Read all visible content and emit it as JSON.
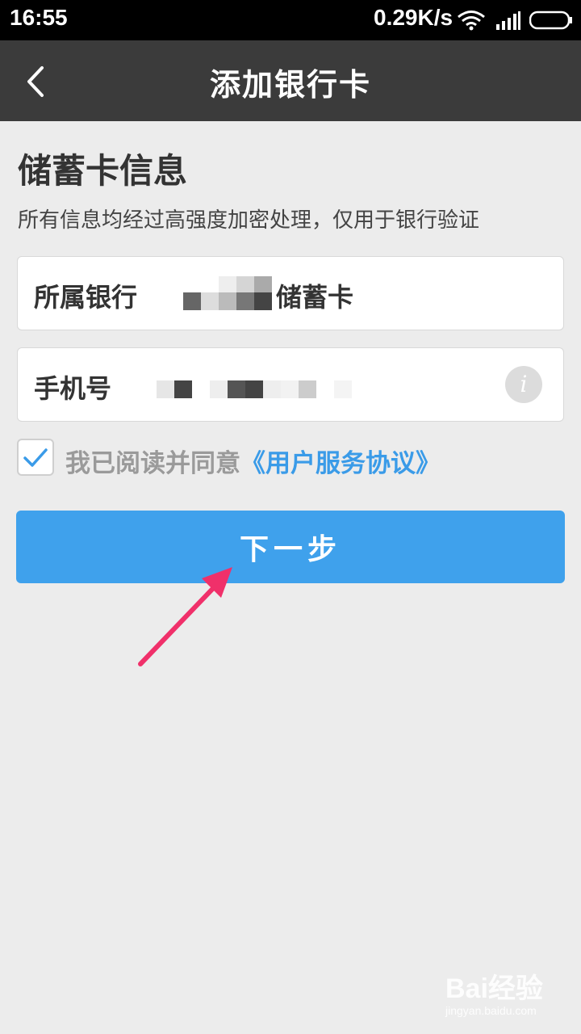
{
  "status_bar": {
    "time": "16:55",
    "speed": "0.29K/s",
    "icons": [
      "wifi-icon",
      "signal-icon",
      "battery-icon"
    ]
  },
  "nav": {
    "title": "添加银行卡",
    "back_icon": "chevron-left-icon"
  },
  "section": {
    "title": "储蓄卡信息",
    "subtitle": "所有信息均经过高强度加密处理，仅用于银行验证"
  },
  "form": {
    "bank_label": "所属银行",
    "bank_value": "储蓄卡",
    "phone_label": "手机号",
    "info_icon_glyph": "i"
  },
  "agreement": {
    "checked": true,
    "text": "我已阅读并同意",
    "link": "《用户服务协议》"
  },
  "next_button": {
    "label": "下一步"
  },
  "watermark": {
    "main": "Bai经验",
    "sub": "jingyan.baidu.com"
  },
  "colors": {
    "nav_bg": "#3b3b3b",
    "page_bg": "#ececec",
    "accent": "#3fa1ec",
    "link": "#3a9be8",
    "annotation_arrow": "#f0306a"
  }
}
